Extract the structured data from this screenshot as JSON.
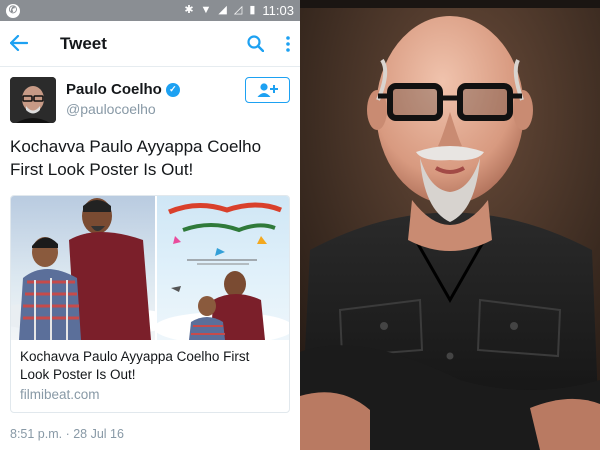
{
  "statusbar": {
    "left_icon": "whatsapp-icon",
    "icons": [
      "bluetooth-icon",
      "wifi-icon",
      "signal-icon",
      "signal-empty-icon",
      "battery-icon"
    ],
    "time": "11:03"
  },
  "appbar": {
    "title": "Tweet",
    "back_icon": "back-arrow-icon",
    "search_icon": "search-icon",
    "more_icon": "more-vertical-icon"
  },
  "tweet": {
    "display_name": "Paulo Coelho",
    "handle": "@paulocoelho",
    "verified": true,
    "text": "Kochavva Paulo Ayyappa Coelho First Look Poster Is Out!",
    "card": {
      "title": "Kochavva Paulo Ayyappa Coelho First Look Poster Is Out!",
      "domain": "filmibeat.com"
    },
    "timestamp": "8:51 p.m. · 28 Jul 16"
  },
  "colors": {
    "accent": "#1da1f2",
    "statusbar": "#8a8e93",
    "secondary_text": "#8899a6"
  }
}
